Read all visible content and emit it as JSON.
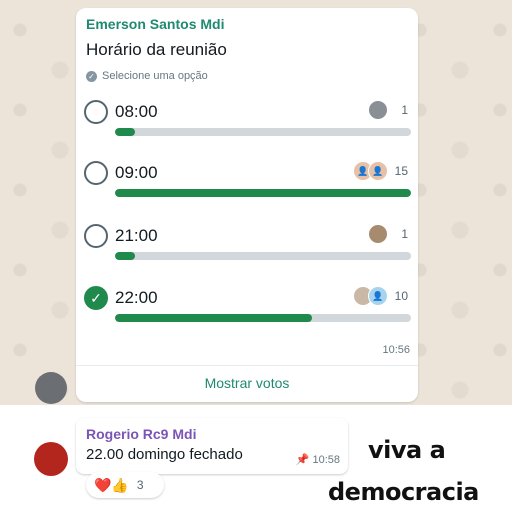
{
  "poll": {
    "sender": "Emerson Santos Mdi",
    "title": "Horário da reunião",
    "hint": "Selecione uma opção",
    "options": [
      {
        "label": "08:00",
        "votes": "1",
        "fraction": 0.067,
        "checked": false
      },
      {
        "label": "09:00",
        "votes": "15",
        "fraction": 1.0,
        "checked": false
      },
      {
        "label": "21:00",
        "votes": "1",
        "fraction": 0.067,
        "checked": false
      },
      {
        "label": "22:00",
        "votes": "10",
        "fraction": 0.667,
        "checked": true
      }
    ],
    "time": "10:56",
    "show_votes": "Mostrar votos",
    "accent_color": "#1f8a4c"
  },
  "message": {
    "sender": "Rogerio Rc9 Mdi",
    "text": "22.00 domingo fechado",
    "pin_icon": "pin-icon",
    "time": "10:58",
    "reactions": {
      "emojis": "❤️👍",
      "count": "3"
    }
  },
  "caption": {
    "line1": "viva a",
    "line2": "democracia"
  }
}
